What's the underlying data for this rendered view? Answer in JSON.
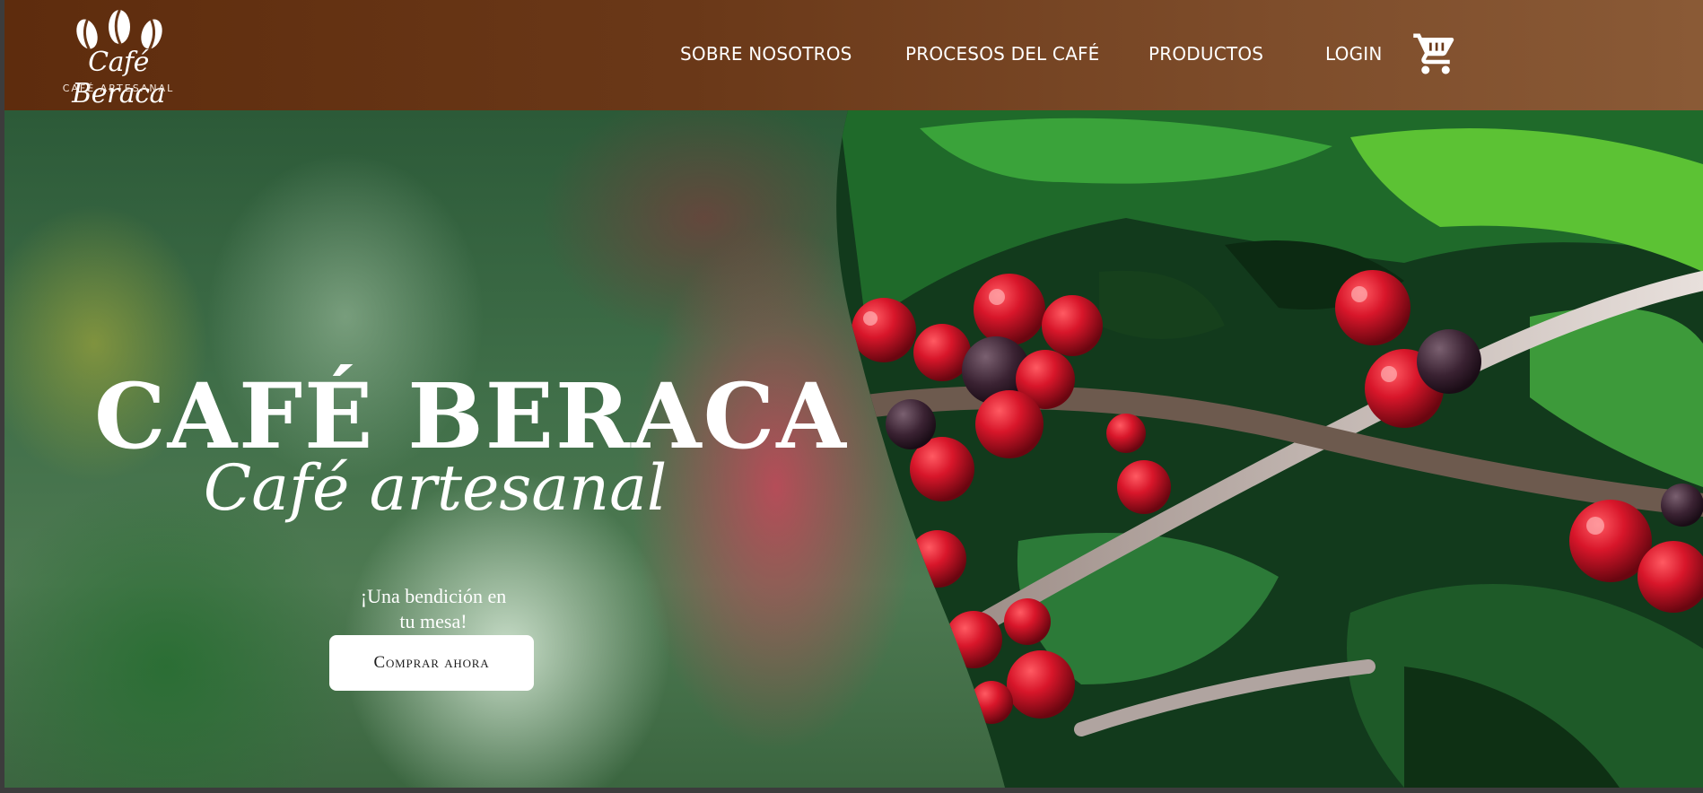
{
  "brand": {
    "name": "Café Beraca",
    "tagline": "CAFÉ ARTESANAL"
  },
  "nav": {
    "items": [
      {
        "label": "SOBRE NOSOTROS"
      },
      {
        "label": "PROCESOS DEL CAFÉ"
      },
      {
        "label": "PRODUCTOS"
      },
      {
        "label": "LOGIN"
      }
    ],
    "cart_icon": "shopping-cart-icon"
  },
  "hero": {
    "title": "CAFÉ BERACA",
    "subtitle": "Café artesanal",
    "tagline_line1": "¡Una bendición en",
    "tagline_line2": "tu mesa!",
    "button_label": "Comprar ahora",
    "image_subject": "coffee-cherries-on-branch"
  },
  "colors": {
    "header_start": "#5e2c0d",
    "header_end": "#8a5a36",
    "button_bg": "#ffffff",
    "text_light": "#ffffff"
  }
}
